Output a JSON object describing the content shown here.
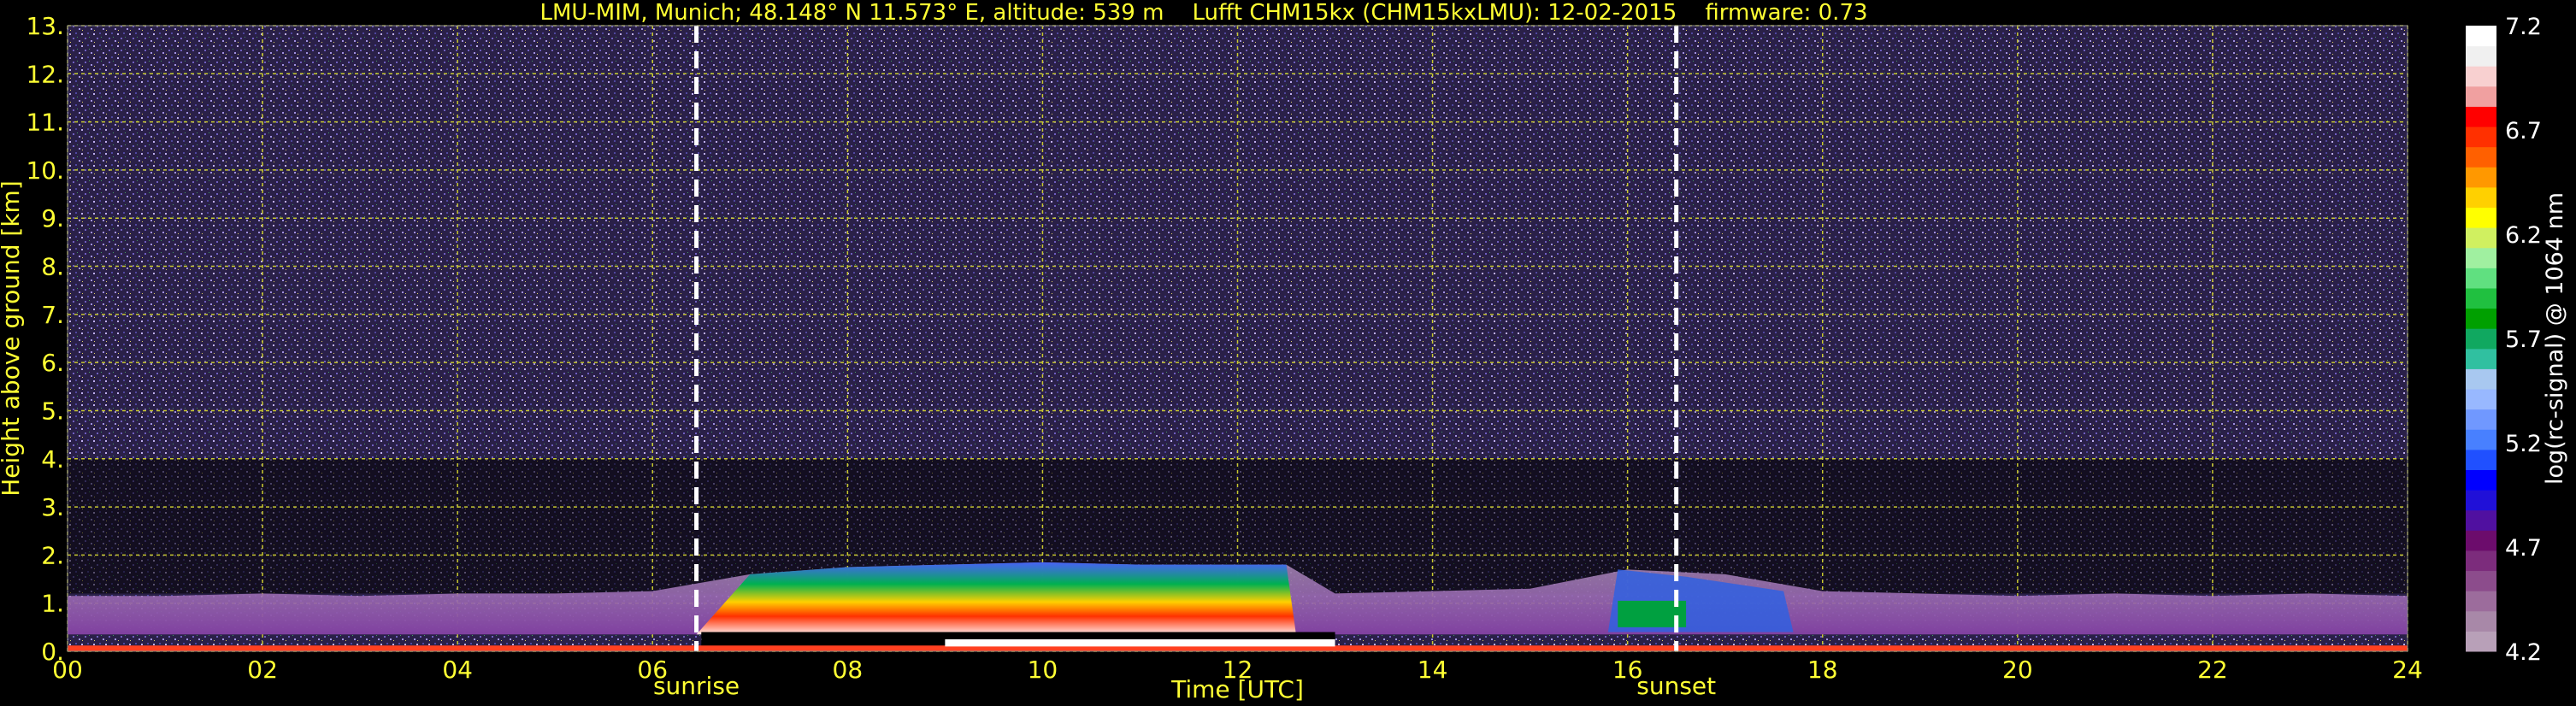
{
  "title": "LMU-MIM, Munich; 48.148° N 11.573° E, altitude: 539 m    Lufft CHM15kx (CHM15kxLMU): 12-02-2015    firmware: 0.73",
  "chart_data": {
    "type": "heatmap",
    "xlabel": "Time [UTC]",
    "ylabel": "Height above ground [km]",
    "xlim": [
      0,
      24
    ],
    "ylim": [
      0,
      13
    ],
    "x_tick_labels": [
      "00",
      "02",
      "04",
      "06",
      "08",
      "10",
      "12",
      "14",
      "16",
      "18",
      "20",
      "22",
      "24"
    ],
    "y_tick_labels": [
      "0.",
      "1.",
      "2.",
      "3.",
      "4.",
      "5.",
      "6.",
      "7.",
      "8.",
      "9.",
      "10.",
      "11.",
      "12.",
      "13."
    ],
    "grid": true,
    "colorbar": {
      "label": "log(rc-signal) @ 1064 nm",
      "range": [
        4.2,
        7.2
      ],
      "tick_labels": [
        "4.2",
        "4.7",
        "5.2",
        "5.7",
        "6.2",
        "6.7",
        "7.2"
      ],
      "colors": [
        "#b8a0b8",
        "#a888a8",
        "#9c6c9c",
        "#8c4c8c",
        "#7c2c7c",
        "#6c0c6c",
        "#5010a0",
        "#2010d8",
        "#0000ff",
        "#2050ff",
        "#4880ff",
        "#7098ff",
        "#98b8ff",
        "#a8c8f0",
        "#30c0a0",
        "#10a860",
        "#00a000",
        "#20c040",
        "#60e080",
        "#a0f0a0",
        "#d0f060",
        "#ffff00",
        "#ffd000",
        "#ff9800",
        "#ff6000",
        "#ff3000",
        "#ff0000",
        "#f0a0a0",
        "#f8d0d0",
        "#f0f0f0",
        "#ffffff"
      ]
    },
    "events": [
      {
        "label": "sunrise",
        "time": 6.45
      },
      {
        "label": "sunset",
        "time": 16.5
      }
    ],
    "boundary_layer": [
      {
        "t": 0,
        "top": 1.15
      },
      {
        "t": 1,
        "top": 1.15
      },
      {
        "t": 2,
        "top": 1.2
      },
      {
        "t": 3,
        "top": 1.15
      },
      {
        "t": 4,
        "top": 1.2
      },
      {
        "t": 5,
        "top": 1.2
      },
      {
        "t": 6,
        "top": 1.25
      },
      {
        "t": 7,
        "top": 1.6
      },
      {
        "t": 8,
        "top": 1.75
      },
      {
        "t": 9,
        "top": 1.8
      },
      {
        "t": 10,
        "top": 1.85
      },
      {
        "t": 11,
        "top": 1.8
      },
      {
        "t": 12,
        "top": 1.8
      },
      {
        "t": 12.5,
        "top": 1.8
      },
      {
        "t": 13,
        "top": 1.2
      },
      {
        "t": 14,
        "top": 1.25
      },
      {
        "t": 15,
        "top": 1.3
      },
      {
        "t": 16,
        "top": 1.7
      },
      {
        "t": 17,
        "top": 1.6
      },
      {
        "t": 18,
        "top": 1.25
      },
      {
        "t": 19,
        "top": 1.2
      },
      {
        "t": 20,
        "top": 1.15
      },
      {
        "t": 21,
        "top": 1.2
      },
      {
        "t": 22,
        "top": 1.15
      },
      {
        "t": 23,
        "top": 1.2
      },
      {
        "t": 24,
        "top": 1.15
      }
    ]
  }
}
